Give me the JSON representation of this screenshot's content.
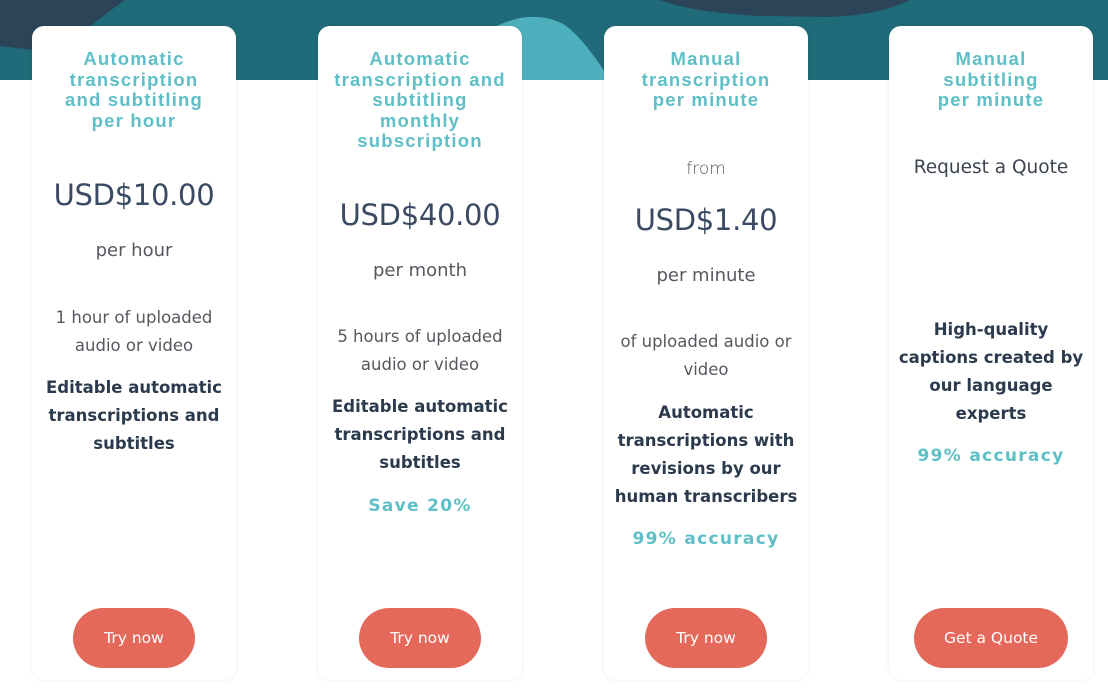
{
  "colors": {
    "hero_teal": "#1f6b79",
    "hero_navy": "#2b4458",
    "hero_light_teal": "#4fb0bd",
    "title_teal": "#5fbfc6",
    "cta_coral": "#e4695a",
    "price_navy": "#3a4a63",
    "feature_dark": "#2c3a4e"
  },
  "plans": [
    {
      "title": "Automatic\ntranscription\nand subtitling\nper hour",
      "from": "",
      "price": "USD$10.00",
      "unit": "per hour",
      "quota": "1 hour of uploaded\naudio or video",
      "feature": "Editable automatic\ntranscriptions and\nsubtitles",
      "highlight": "",
      "cta": "Try now"
    },
    {
      "title": "Automatic\ntranscription and\nsubtitling\nmonthly\nsubscription",
      "from": "",
      "price": "USD$40.00",
      "unit": "per month",
      "quota": "5 hours of uploaded\naudio or video",
      "feature": "Editable automatic\ntranscriptions and\nsubtitles",
      "highlight": "Save 20%",
      "cta": "Try now"
    },
    {
      "title": "Manual\ntranscription\nper minute",
      "from": "from",
      "price": "USD$1.40",
      "unit": "per minute",
      "quota": "of uploaded audio or\nvideo",
      "feature": "Automatic\ntranscriptions with\nrevisions by our\nhuman transcribers",
      "highlight": "99% accuracy",
      "cta": "Try now"
    },
    {
      "title": "Manual\nsubtitling\nper minute",
      "request": "Request a Quote",
      "feature": "High-quality\ncaptions created by\nour language\nexperts",
      "highlight": "99% accuracy",
      "cta": "Get a Quote"
    }
  ]
}
